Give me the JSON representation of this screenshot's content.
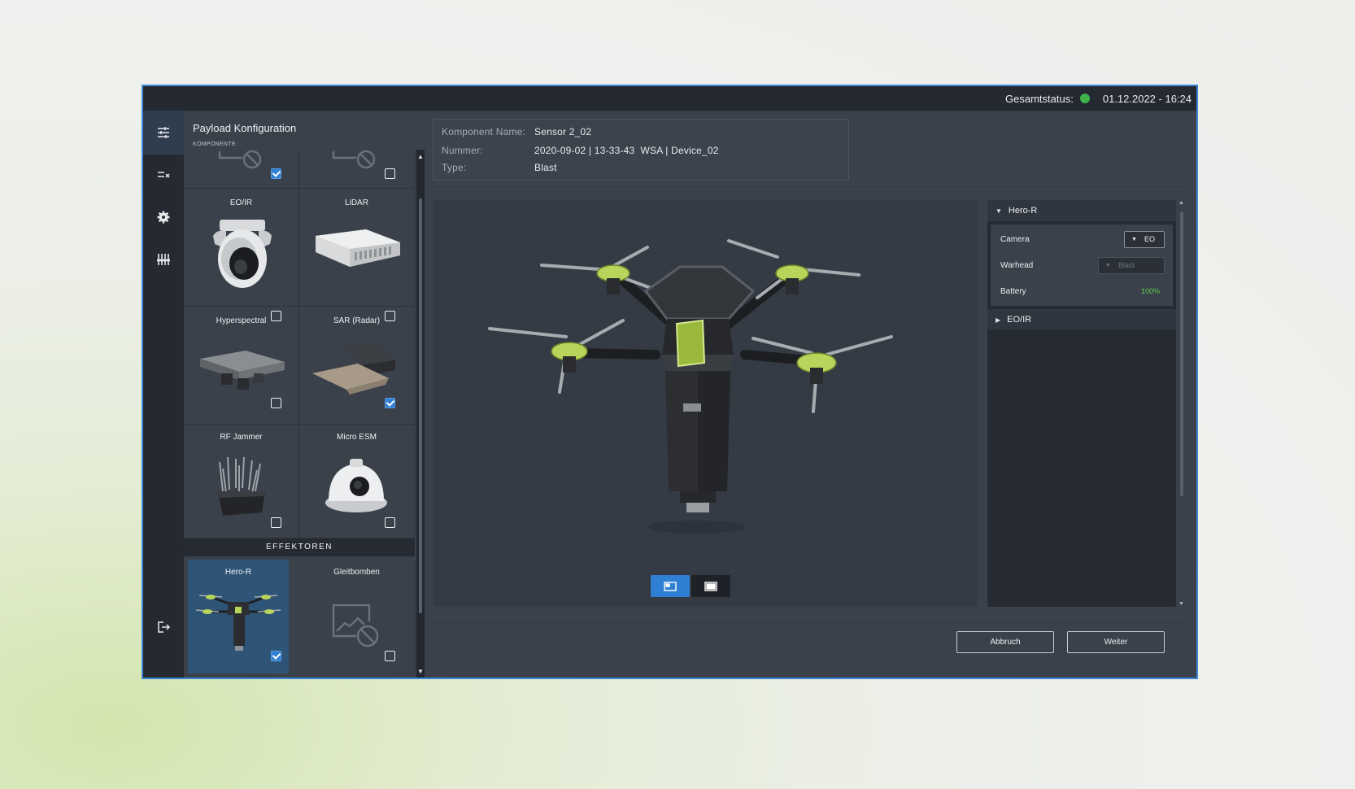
{
  "header": {
    "status_label": "Gesamtstatus:",
    "status_color": "#3fb44a",
    "datetime": "01.12.2022 - 16:24"
  },
  "rail": {
    "items": [
      "sliders-icon",
      "list-check-icon",
      "gear-icon",
      "equalizer-icon"
    ],
    "logout": "logout-icon"
  },
  "panel": {
    "title": "Payload Konfiguration",
    "subtitle": "KOMPONENTE",
    "tiles": [
      {
        "label": "",
        "checked": true
      },
      {
        "label": "",
        "checked": false
      },
      {
        "label": "EO/IR",
        "checked": false
      },
      {
        "label": "LiDAR",
        "checked": false
      },
      {
        "label": "Hyperspectral",
        "checked": false
      },
      {
        "label": "SAR (Radar)",
        "checked": true
      },
      {
        "label": "RF Jammer",
        "checked": false
      },
      {
        "label": "Micro ESM",
        "checked": false
      }
    ],
    "section_effektoren": "EFFEKTOREN",
    "effektoren": [
      {
        "label": "Hero-R",
        "checked": true,
        "selected": true
      },
      {
        "label": "Gleitbomben",
        "checked": false
      }
    ]
  },
  "info": {
    "name_key": "Komponent Name:",
    "name_val": "Sensor 2_02",
    "num_key": "Nummer:",
    "num_val": "2020-09-02 | 13-33-43  WSA | Device_02",
    "type_key": "Type:",
    "type_val": "Blast"
  },
  "viewer": {
    "accent_color": "#2f7fd4"
  },
  "props": {
    "group1": "Hero-R",
    "camera_label": "Camera",
    "camera_value": "EO",
    "warhead_label": "Warhead",
    "warhead_value": "Blast",
    "battery_label": "Battery",
    "battery_value": "100%",
    "battery_color": "#5fd14a",
    "group2": "EO/IR"
  },
  "footer": {
    "cancel": "Abbruch",
    "next": "Weiter"
  }
}
